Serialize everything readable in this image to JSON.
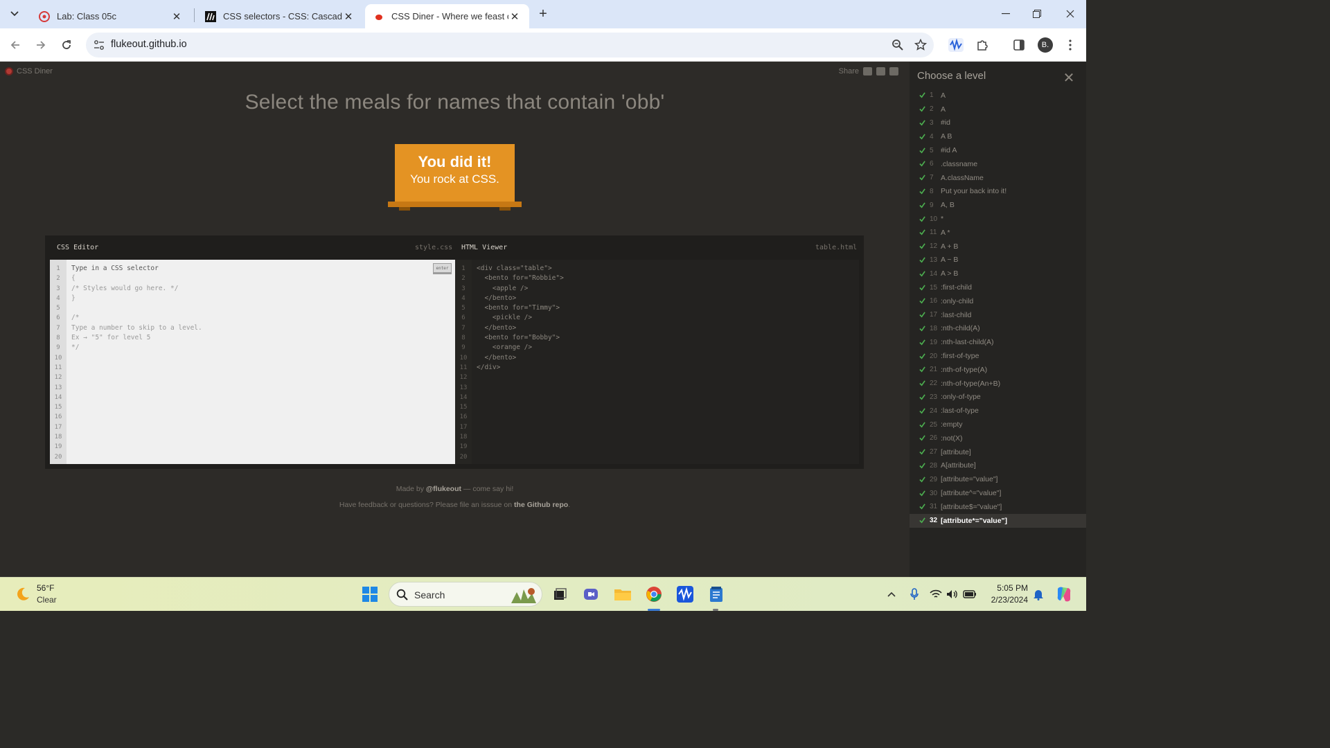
{
  "browser": {
    "tabs": [
      {
        "title": "Lab: Class 05c",
        "active": false
      },
      {
        "title": "CSS selectors - CSS: Cascading",
        "active": false
      },
      {
        "title": "CSS Diner - Where we feast on",
        "active": true
      }
    ],
    "url": "flukeout.github.io",
    "profile_initial": "B."
  },
  "game": {
    "logo_text": "CSS Diner",
    "share_label": "Share",
    "instruction": "Select the meals for names that contain 'obb'",
    "winner_line1": "You did it!",
    "winner_line2": "You rock at CSS."
  },
  "editor": {
    "css_title": "CSS Editor",
    "css_file": "style.css",
    "html_title": "HTML Viewer",
    "html_file": "table.html",
    "enter_label": "enter",
    "line_numbers": "1\n2\n3\n4\n5\n6\n7\n8\n9\n10\n11\n12\n13\n14\n15\n16\n17\n18\n19\n20",
    "css_placeholder": "Type in a CSS selector",
    "css_code": "{\n/* Styles would go here. */\n}\n\n/*\nType a number to skip to a level.\nEx → \"5\" for level 5\n*/",
    "html_code": "<div class=\"table\">\n  <bento for=\"Robbie\">\n    <apple />\n  </bento>\n  <bento for=\"Timmy\">\n    <pickle />\n  </bento>\n  <bento for=\"Bobby\">\n    <orange />\n  </bento>\n</div>"
  },
  "credits": {
    "line1_prefix": "Made by",
    "line1_link": "@flukeout",
    "line1_suffix": "— come say hi!",
    "line2_prefix": "Have feedback or questions? Please file an isssue on",
    "line2_link": "the Github repo",
    "line2_suffix": "."
  },
  "levels": {
    "title": "Choose a level",
    "items": [
      {
        "num": "1",
        "name": "A"
      },
      {
        "num": "2",
        "name": "A"
      },
      {
        "num": "3",
        "name": "#id"
      },
      {
        "num": "4",
        "name": "A B"
      },
      {
        "num": "5",
        "name": "#id A"
      },
      {
        "num": "6",
        "name": ".classname"
      },
      {
        "num": "7",
        "name": "A.className"
      },
      {
        "num": "8",
        "name": "Put your back into it!"
      },
      {
        "num": "9",
        "name": "A, B"
      },
      {
        "num": "10",
        "name": "*"
      },
      {
        "num": "11",
        "name": "A *"
      },
      {
        "num": "12",
        "name": "A + B"
      },
      {
        "num": "13",
        "name": "A ~ B"
      },
      {
        "num": "14",
        "name": "A > B"
      },
      {
        "num": "15",
        "name": ":first-child"
      },
      {
        "num": "16",
        "name": ":only-child"
      },
      {
        "num": "17",
        "name": ":last-child"
      },
      {
        "num": "18",
        "name": ":nth-child(A)"
      },
      {
        "num": "19",
        "name": ":nth-last-child(A)"
      },
      {
        "num": "20",
        "name": ":first-of-type"
      },
      {
        "num": "21",
        "name": ":nth-of-type(A)"
      },
      {
        "num": "22",
        "name": ":nth-of-type(An+B)"
      },
      {
        "num": "23",
        "name": ":only-of-type"
      },
      {
        "num": "24",
        "name": ":last-of-type"
      },
      {
        "num": "25",
        "name": ":empty"
      },
      {
        "num": "26",
        "name": ":not(X)"
      },
      {
        "num": "27",
        "name": "[attribute]"
      },
      {
        "num": "28",
        "name": "A[attribute]"
      },
      {
        "num": "29",
        "name": "[attribute=\"value\"]"
      },
      {
        "num": "30",
        "name": "[attribute^=\"value\"]"
      },
      {
        "num": "31",
        "name": "[attribute$=\"value\"]"
      },
      {
        "num": "32",
        "name": "[attribute*=\"value\"]"
      }
    ],
    "current": "32"
  },
  "taskbar": {
    "temperature": "56°F",
    "condition": "Clear",
    "search_label": "Search",
    "time": "5:05 PM",
    "date": "2/23/2024"
  },
  "colors": {
    "page_bg": "#2d2b28",
    "accent_orange": "#e49323",
    "check_green": "#4caf50"
  }
}
